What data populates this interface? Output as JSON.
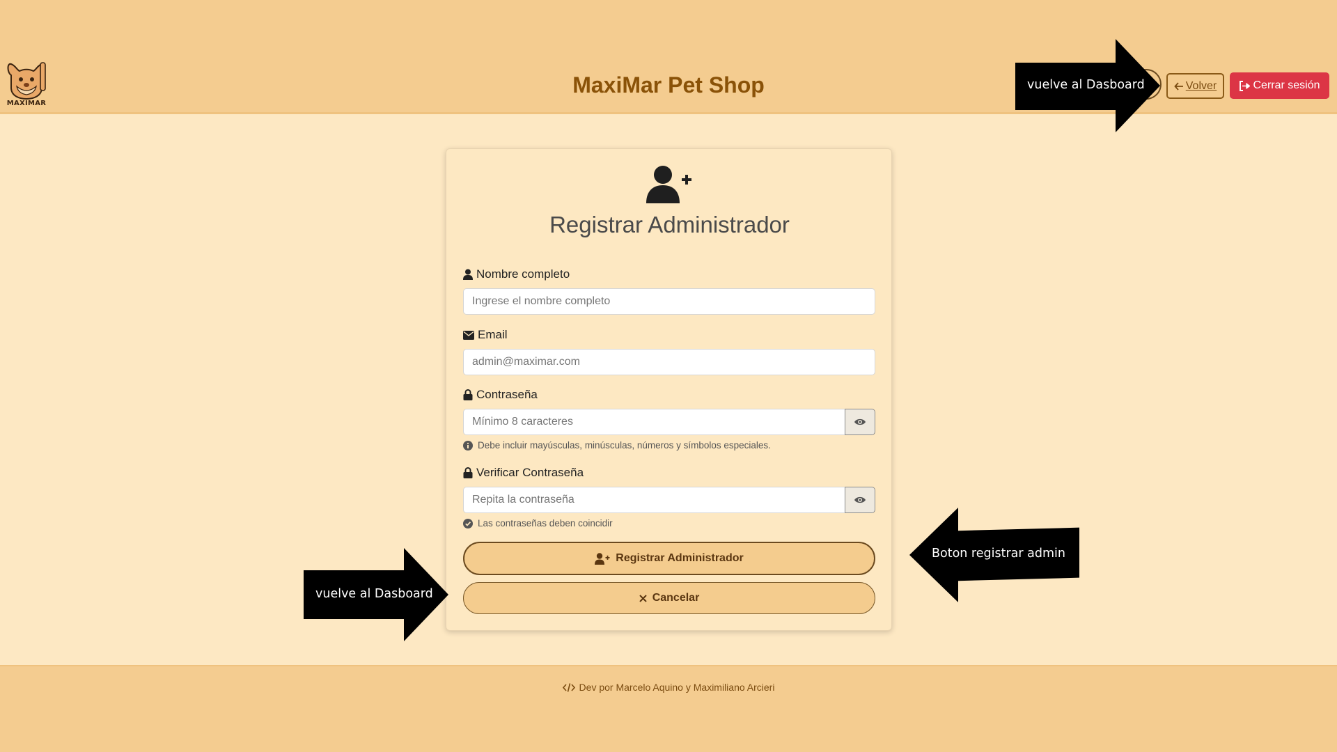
{
  "app": {
    "brand": "MaxiMar Pet Shop",
    "logo_text": "MAXIMAR"
  },
  "header": {
    "back_label": "Volver",
    "logout_label": "Cerrar sesión"
  },
  "form": {
    "title": "Registrar Administrador",
    "name": {
      "label": "Nombre completo",
      "placeholder": "Ingrese el nombre completo"
    },
    "email": {
      "label": "Email",
      "placeholder": "admin@maximar.com"
    },
    "password": {
      "label": "Contraseña",
      "placeholder": "Mínimo 8 caracteres",
      "hint": "Debe incluir mayúsculas, minúsculas, números y símbolos especiales."
    },
    "verify": {
      "label": "Verificar Contraseña",
      "placeholder": "Repita la contraseña",
      "hint": "Las contraseñas deben coincidir"
    },
    "submit_label": "Registrar Administrador",
    "cancel_label": "Cancelar"
  },
  "footer": {
    "text": "Dev por Marcelo Aquino y Maximiliano Arcieri"
  },
  "annotations": {
    "volver_note": "vuelve al Dasboard",
    "cancel_note": "vuelve al Dasboard",
    "submit_note": "Boton registrar admin"
  },
  "colors": {
    "header_bg": "#f4cc90",
    "page_bg": "#fde8c3",
    "brand": "#8a5208",
    "logout": "#dc3545"
  },
  "icons": [
    "user-plus-icon",
    "user-icon",
    "envelope-icon",
    "lock-icon",
    "eye-icon",
    "info-icon",
    "check-circle-icon",
    "arrow-left-icon",
    "sign-out-icon",
    "times-icon",
    "code-icon"
  ]
}
